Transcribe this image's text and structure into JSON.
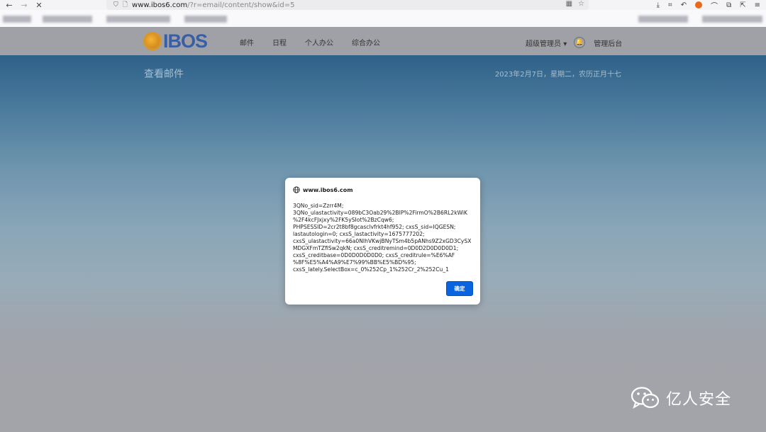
{
  "browser": {
    "back_icon": "arrow-left-icon",
    "forward_icon": "arrow-right-icon",
    "stop_icon": "close-icon",
    "url_host": "www.ibos6.com",
    "url_path": "/?r=email/content/show&id=5"
  },
  "site": {
    "logo_text": "IBOS",
    "nav": [
      "邮件",
      "日程",
      "个人办公",
      "综合办公"
    ],
    "user_menu": "超级管理员",
    "user_menu_caret": "▾",
    "admin_link": "管理后台"
  },
  "page": {
    "title": "查看邮件",
    "date": "2023年2月7日，星期二，农历正月十七"
  },
  "dialog": {
    "origin": "www.ibos6.com",
    "lines": [
      "3QNo_sid=Zzrr4M;",
      "3QNo_ulastactivity=089bC3Oab29%2BIP%2FirmO%2B6RL2kWiK",
      "%2F4kcFJxjxy%2FK5ySIot%2BzCqw6;",
      "PHPSESSID=2cr2t8bf8gcasclvfrkt4hf952; cxsS_sid=IQGESN;",
      "lastautologin=0; cxsS_lastactivity=1675777202;",
      "cxsS_ulastactivity=66a0NIhVKwjBNyTSm4b5pANhs9Z2xGD3CySX",
      "MDGXFmTZfiSw2qkN; cxsS_creditremind=0D0D2D0D0D0D1;",
      "cxsS_creditbase=0D0D0D0D0D0; cxsS_creditrule=%E6%AF",
      "%8F%E5%A4%A9%E7%99%BB%E5%BD%95;",
      "cxsS_lately.SelectBox=c_0%252Cp_1%252Cr_2%252Cu_1"
    ],
    "ok_label": "确定"
  },
  "watermark": {
    "text": "亿人安全",
    "icon": "wechat-icon"
  },
  "colors": {
    "accent": "#0a64e0",
    "logo_blue": "#385fa5",
    "logo_orange": "#e09a25"
  }
}
